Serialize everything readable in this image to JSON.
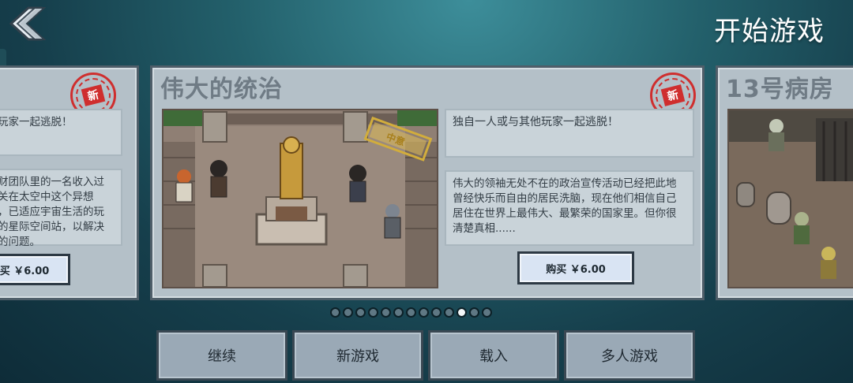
{
  "header": {
    "title": "开始游戏"
  },
  "cards": {
    "left": {
      "stamp_text": "新",
      "subtitle": "玩家一起逃脱！",
      "description": "财团队里的一名收入过\n关在太空中这个异想\n，已适应宇宙生活的玩\n的星际空间站，以解决\n的问题。",
      "buy_label": "买 ￥6.00"
    },
    "center": {
      "title": "伟大的统治",
      "stamp_text": "新",
      "art_badge": "中意",
      "subtitle": "独自一人或与其他玩家一起逃脱！",
      "description": "伟大的领袖无处不在的政治宣传活动已经把此地曾经快乐而自由的居民洗脑，现在他们相信自己居住在世界上最伟大、最繁荣的国家里。但你很清楚真相......",
      "buy_label": "购买 ￥6.00"
    },
    "right": {
      "title": "13号病房"
    }
  },
  "pager": {
    "total": 13,
    "active_index": 10
  },
  "menu": {
    "continue_label": "继续",
    "new_game_label": "新游戏",
    "load_label": "载入",
    "multiplayer_label": "多人游戏"
  },
  "colors": {
    "stamp_red": "#cf2e2e",
    "card_bg": "#b4c0c8",
    "button_bg": "#9aa9b6"
  }
}
